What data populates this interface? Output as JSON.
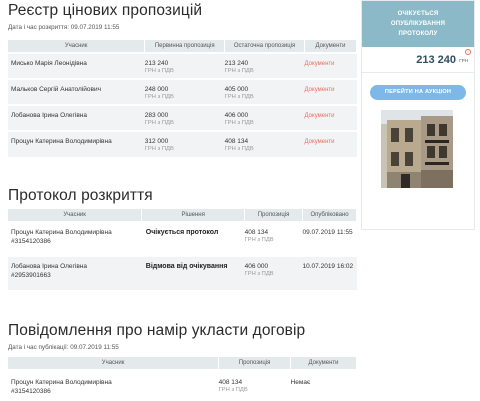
{
  "registry": {
    "title": "Реєстр цінових пропозицій",
    "date_label": "Дата і час розкриття: 09.07.2019 11:55",
    "headers": [
      "Учасник",
      "Первинна пропозиція",
      "Остаточна пропозиція",
      "Документи"
    ],
    "rows": [
      {
        "name": "Миськo Марія Леонідівна",
        "initial": "213 240",
        "final": "213 240",
        "vat": "ГРН з ПДВ",
        "docs": "Документи"
      },
      {
        "name": "Мальков Сергій Анатолійович",
        "initial": "248 000",
        "final": "405 000",
        "vat": "ГРН з ПДВ",
        "docs": "Документи"
      },
      {
        "name": "Лобанова Ірина Олегівна",
        "initial": "283 000",
        "final": "406 000",
        "vat": "ГРН з ПДВ",
        "docs": "Документи"
      },
      {
        "name": "Процун Катерина Володимирівна",
        "initial": "312 000",
        "final": "408 134",
        "vat": "ГРН з ПДВ",
        "docs": "Документи"
      }
    ]
  },
  "protocol": {
    "title": "Протокол розкриття",
    "headers": [
      "Учасник",
      "Рішення",
      "Пропозиція",
      "Опубліковано"
    ],
    "rows": [
      {
        "name": "Процун Катерина Володимирівна",
        "id": "#3154120386",
        "decision": "Очікується протокол",
        "amount": "408 134",
        "vat": "ГРН з ПДВ",
        "published": "09.07.2019 11:55"
      },
      {
        "name": "Лобанова Ірина Олегівна",
        "id": "#2953901663",
        "decision": "Відмова від очікування",
        "amount": "406 000",
        "vat": "ГРН з ПДВ",
        "published": "10.07.2019 16:02"
      }
    ]
  },
  "notice": {
    "title": "Повідомлення про намір укласти договір",
    "date_label": "Дата і час публікації: 09.07.2019 11:55",
    "headers": [
      "Учасник",
      "Пропозиція",
      "Документи"
    ],
    "rows": [
      {
        "name": "Процун Катерина Володимирівна",
        "id": "#3154120386",
        "amount": "408 134",
        "vat": "ГРН з ПДВ",
        "docs": "Немає"
      }
    ]
  },
  "sidebar": {
    "status": [
      "ОЧІКУЄТЬСЯ",
      "ОПУБЛІКУВАННЯ",
      "ПРОТОКОЛУ"
    ],
    "price": "213 240",
    "currency": "ГРН",
    "info_glyph": "i",
    "auction_button": "ПЕРЕЙТИ НА АУКЦІОН",
    "photo_icon": "building-photo",
    "colors": {
      "banner": "#8cb9c7",
      "button": "#7db8e8",
      "price": "#2e4e63",
      "link": "#e8705e"
    }
  }
}
